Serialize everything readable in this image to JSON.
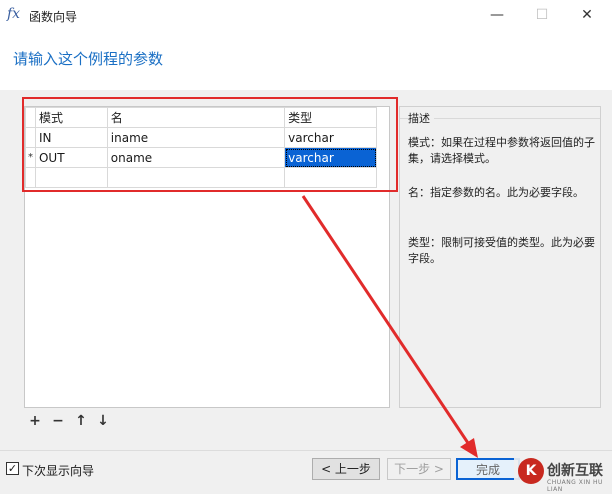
{
  "window": {
    "icon": "fx-icon",
    "title": "函数向导",
    "minimize_glyph": "—",
    "maximize_glyph": "☐",
    "close_glyph": "✕"
  },
  "heading": "请输入这个例程的参数",
  "params_grid": {
    "columns": [
      "模式",
      "名",
      "类型"
    ],
    "rows": [
      {
        "marker": "",
        "mode": "IN",
        "name": "iname",
        "type": "varchar"
      },
      {
        "marker": "*",
        "mode": "OUT",
        "name": "oname",
        "type": "varchar"
      }
    ],
    "selected_cell": "rows.1.type"
  },
  "description": {
    "title": "描述",
    "mode_text": "模式：如果在过程中参数将返回值的子集，请选择模式。",
    "name_text": "名：指定参数的名。此为必要字段。",
    "type_text": "类型：限制可接受值的类型。此为必要字段。"
  },
  "toolbar": {
    "add": "+",
    "remove": "−",
    "move_up": "↑",
    "move_down": "↓"
  },
  "footer": {
    "show_wizard_checked": true,
    "show_wizard_label": "下次显示向导",
    "prev_label": "< 上一步",
    "next_label": "下一步 >",
    "finish_label": "完成"
  },
  "annotation": {
    "box_color": "#e12b2b",
    "arrow_color": "#e12b2b"
  },
  "watermark": {
    "logo_glyph": "K",
    "text": "创新互联",
    "subtext": "CHUANG XIN HU LIAN"
  },
  "colors": {
    "heading": "#1a6fc4",
    "selection": "#0a63d4"
  }
}
